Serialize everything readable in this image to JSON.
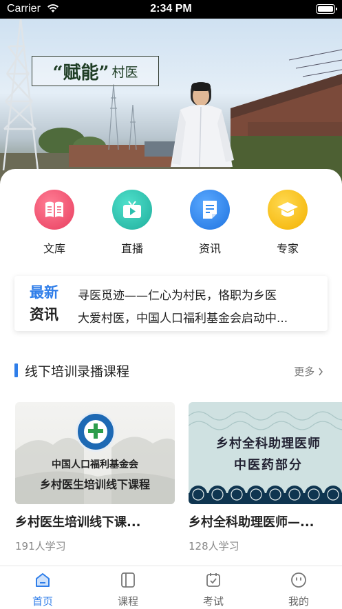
{
  "status_bar": {
    "carrier": "Carrier",
    "time": "2:34 PM"
  },
  "hero": {
    "caption_big": "“赋能”",
    "caption_small": "村医"
  },
  "quick_nav": [
    {
      "label": "文库",
      "icon": "book-icon",
      "color": "#f0526f"
    },
    {
      "label": "直播",
      "icon": "live-tv-icon",
      "color": "#2bbfae"
    },
    {
      "label": "资讯",
      "icon": "document-icon",
      "color": "#2f88ef"
    },
    {
      "label": "专家",
      "icon": "graduation-cap-icon",
      "color": "#f7c31b"
    }
  ],
  "news": {
    "tag_line1": "最新",
    "tag_line2": "资讯",
    "items": [
      "寻医觅迹——仁心为村民，恪职为乡医",
      "大爱村医，中国人口福利基金会启动中..."
    ]
  },
  "section": {
    "title": "线下培训录播课程",
    "more": "更多"
  },
  "courses": [
    {
      "title": "乡村医生培训线下课...",
      "learners": "191人学习",
      "thumb_line1": "中国人口福利基金会",
      "thumb_line2": "乡村医生培训线下课程"
    },
    {
      "title": "乡村全科助理医师—...",
      "learners": "128人学习",
      "thumb_line1": "乡村全科助理医师",
      "thumb_line2": "中医药部分"
    }
  ],
  "tabbar": [
    {
      "label": "首页",
      "icon": "home-icon",
      "active": true
    },
    {
      "label": "课程",
      "icon": "course-book-icon",
      "active": false
    },
    {
      "label": "考试",
      "icon": "exam-calendar-icon",
      "active": false
    },
    {
      "label": "我的",
      "icon": "profile-face-icon",
      "active": false
    }
  ],
  "colors": {
    "accent": "#2f7ee9",
    "text": "#222222",
    "muted": "#888888"
  }
}
